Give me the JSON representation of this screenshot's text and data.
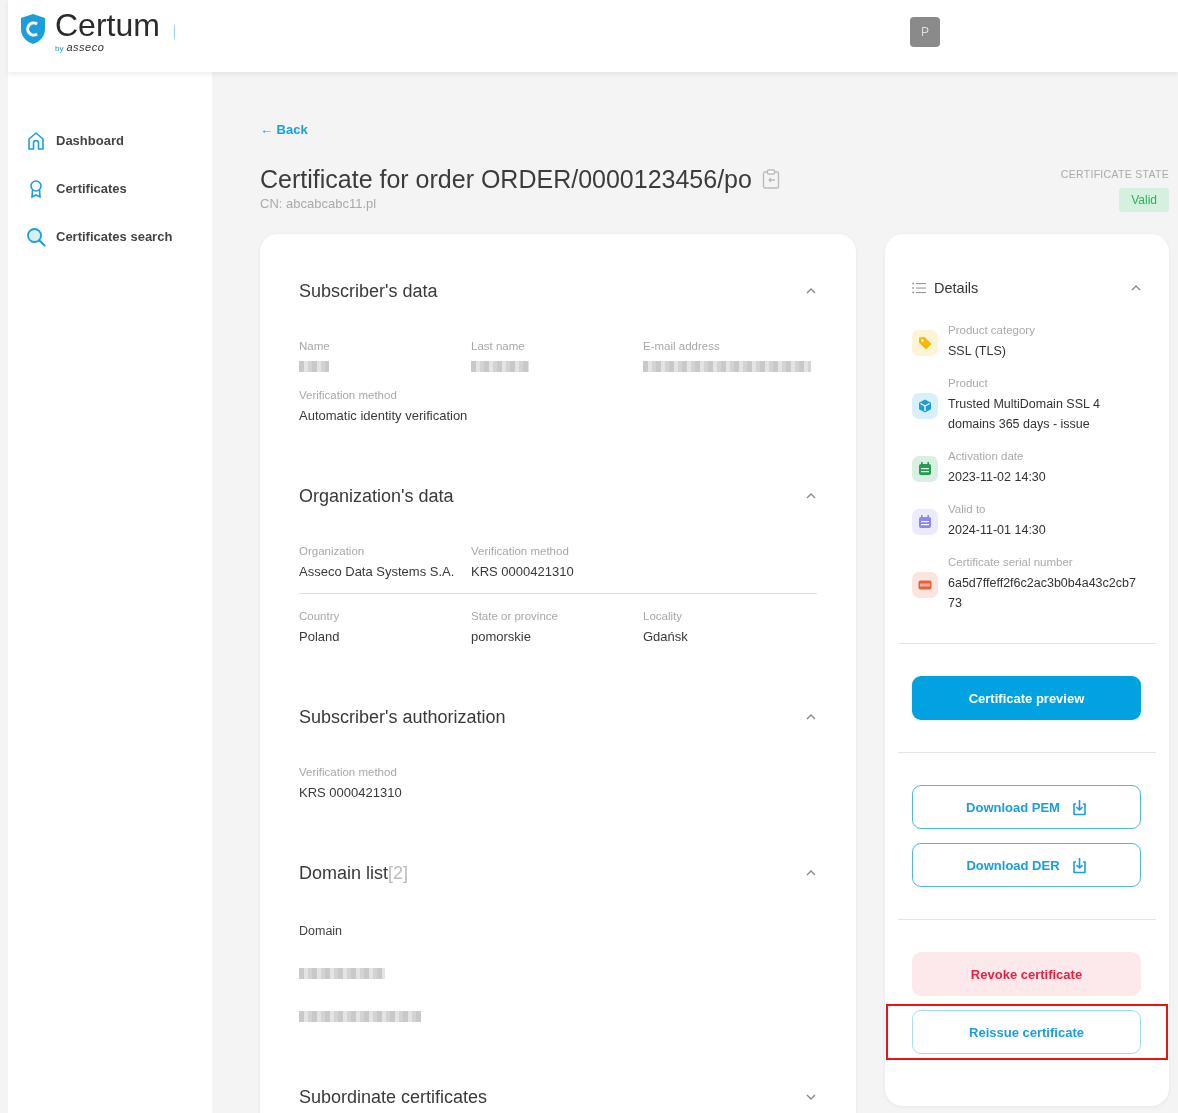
{
  "header": {
    "logo": {
      "name": "Certum",
      "by": "by",
      "brand": "asseco"
    },
    "avatar": "P"
  },
  "sidebar": {
    "items": [
      {
        "label": "Dashboard",
        "selected": false
      },
      {
        "label": "Certificates",
        "selected": false
      },
      {
        "label": "Certificates search",
        "selected": false
      }
    ]
  },
  "back": {
    "arrow": "←",
    "label": "Back"
  },
  "title": "Certificate for order ORDER/0000123456/po",
  "cn": "CN: abcabcabc11.pl",
  "state": {
    "label": "CERTIFICATE STATE",
    "value": "Valid"
  },
  "sections": [
    {
      "title": "Subscriber's data",
      "expanded": true,
      "kind": "fields",
      "groups": [
        [
          {
            "label": "Name",
            "redacted": true
          },
          {
            "label": "Last name",
            "redacted": true
          },
          {
            "label": "E-mail address",
            "redacted": true
          },
          {
            "label": "Verification method",
            "value": "Automatic identity verification"
          }
        ]
      ]
    },
    {
      "title": "Organization's data",
      "expanded": true,
      "kind": "fields",
      "groups": [
        [
          {
            "label": "Organization",
            "value": "Asseco Data Systems S.A."
          },
          {
            "label": "Verification method",
            "value": "KRS 0000421310"
          }
        ],
        [
          {
            "label": "Country",
            "value": "Poland"
          },
          {
            "label": "State or province",
            "value": "pomorskie"
          },
          {
            "label": "Locality",
            "value": "Gdańsk"
          }
        ]
      ]
    },
    {
      "title": "Subscriber's authorization",
      "expanded": true,
      "kind": "fields",
      "groups": [
        [
          {
            "label": "Verification method",
            "value": "KRS 0000421310"
          }
        ]
      ]
    },
    {
      "title": "Domain list",
      "count": "[2]",
      "expanded": true,
      "kind": "list",
      "header": "Domain",
      "items": [
        {
          "redacted": true
        },
        {
          "redacted": true
        }
      ]
    },
    {
      "title": "Subordinate certificates",
      "expanded": false
    }
  ],
  "details": {
    "title": "Details",
    "expanded": true,
    "items": [
      {
        "label": "Product category",
        "value": "SSL (TLS)",
        "kind": "tag",
        "color": "#f5b800"
      },
      {
        "label": "Product",
        "value": "Trusted MultiDomain SSL 4 domains 365 days - issue",
        "kind": "cube",
        "color": "#1a9fdc"
      },
      {
        "label": "Activation date",
        "value": "2023-11-02 14:30",
        "kind": "calendar",
        "color": "#1e9e4e"
      },
      {
        "label": "Valid to",
        "value": "2024-11-01 14:30",
        "kind": "calendar",
        "color": "#8b86f0"
      },
      {
        "label": "Certificate serial number",
        "value": "6a5d7ffeff2f6c2ac3b0b4a43c2cb773",
        "kind": "serial",
        "color": "#e8603c"
      }
    ]
  },
  "actions": [
    [
      {
        "label": "Certificate preview",
        "kind": "primary",
        "highlighted": false
      }
    ],
    [
      {
        "label": "Download PEM",
        "kind": "download",
        "highlighted": false
      },
      {
        "label": "Download DER",
        "kind": "download",
        "highlighted": false
      }
    ],
    [
      {
        "label": "Revoke certificate",
        "kind": "danger",
        "highlighted": false
      },
      {
        "label": "Reissue certificate",
        "kind": "light",
        "highlighted": true
      }
    ]
  ]
}
